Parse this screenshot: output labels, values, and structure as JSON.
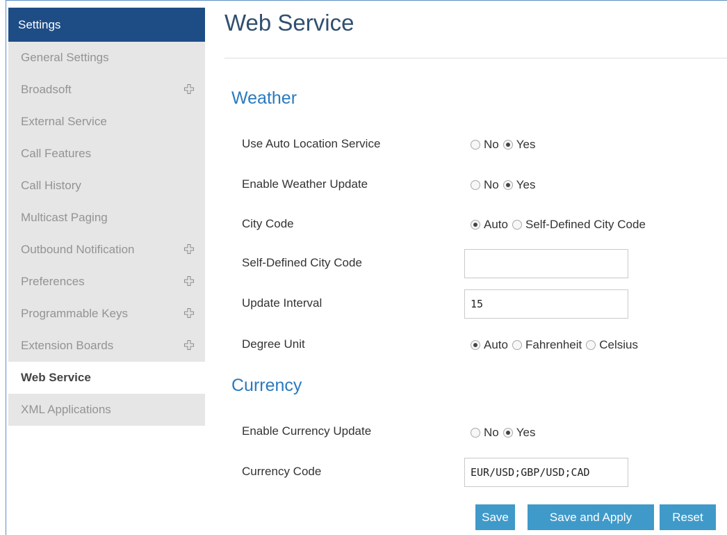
{
  "sidebar": {
    "header": "Settings",
    "items": [
      {
        "label": "General Settings",
        "expandable": false,
        "active": false
      },
      {
        "label": "Broadsoft",
        "expandable": true,
        "active": false
      },
      {
        "label": "External Service",
        "expandable": false,
        "active": false
      },
      {
        "label": "Call Features",
        "expandable": false,
        "active": false
      },
      {
        "label": "Call History",
        "expandable": false,
        "active": false
      },
      {
        "label": "Multicast Paging",
        "expandable": false,
        "active": false
      },
      {
        "label": "Outbound Notification",
        "expandable": true,
        "active": false
      },
      {
        "label": "Preferences",
        "expandable": true,
        "active": false
      },
      {
        "label": "Programmable Keys",
        "expandable": true,
        "active": false
      },
      {
        "label": "Extension Boards",
        "expandable": true,
        "active": false
      },
      {
        "label": "Web Service",
        "expandable": false,
        "active": true
      },
      {
        "label": "XML Applications",
        "expandable": false,
        "active": false
      }
    ],
    "expand_icon": "plus-icon"
  },
  "page": {
    "title": "Web Service"
  },
  "weather": {
    "title": "Weather",
    "auto_location": {
      "label": "Use Auto Location Service",
      "options": [
        "No",
        "Yes"
      ],
      "selected": "Yes"
    },
    "weather_update": {
      "label": "Enable Weather Update",
      "options": [
        "No",
        "Yes"
      ],
      "selected": "Yes"
    },
    "city_code": {
      "label": "City Code",
      "options": [
        "Auto",
        "Self-Defined City Code"
      ],
      "selected": "Auto"
    },
    "self_defined_city_code": {
      "label": "Self-Defined City Code",
      "value": ""
    },
    "update_interval": {
      "label": "Update Interval",
      "value": "15"
    },
    "degree_unit": {
      "label": "Degree Unit",
      "options": [
        "Auto",
        "Fahrenheit",
        "Celsius"
      ],
      "selected": "Auto"
    }
  },
  "currency": {
    "title": "Currency",
    "currency_update": {
      "label": "Enable Currency Update",
      "options": [
        "No",
        "Yes"
      ],
      "selected": "Yes"
    },
    "currency_code": {
      "label": "Currency Code",
      "value": "EUR/USD;GBP/USD;CAD"
    }
  },
  "buttons": {
    "save": "Save",
    "save_apply": "Save and Apply",
    "reset": "Reset"
  },
  "colors": {
    "sidebar_header": "#1e4d86",
    "sidebar_bg": "#e6e6e6",
    "accent_title": "#2a7abf",
    "button": "#3f9ac9"
  }
}
